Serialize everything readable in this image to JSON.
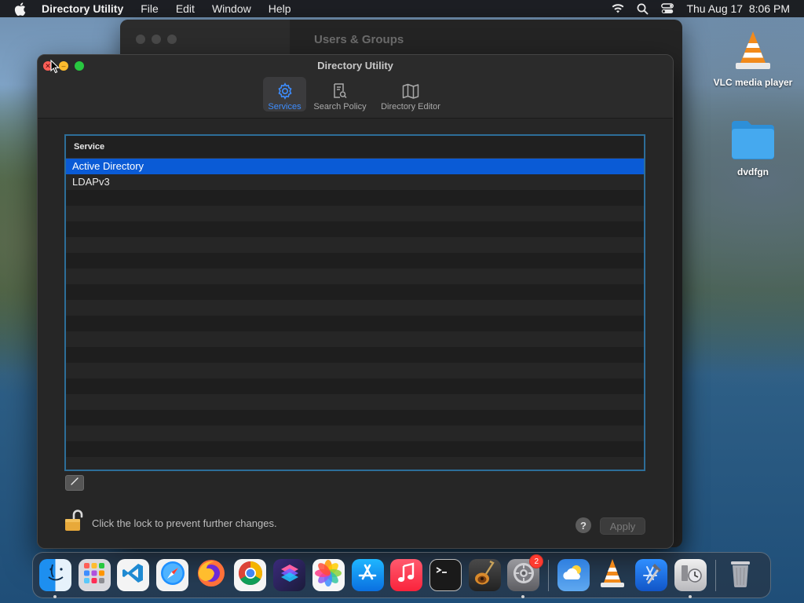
{
  "menubar": {
    "app_name": "Directory Utility",
    "items": [
      "File",
      "Edit",
      "Window",
      "Help"
    ],
    "datetime": "Thu Aug 17  8:06 PM"
  },
  "desktop": {
    "icons": [
      {
        "label": "VLC media player",
        "icon": "vlc-cone-icon"
      },
      {
        "label": "dvdfgn",
        "icon": "folder-icon"
      }
    ]
  },
  "background_window": {
    "title": "Users & Groups"
  },
  "window": {
    "title": "Directory Utility",
    "toolbar": [
      {
        "label": "Services",
        "icon": "gear-icon",
        "active": true
      },
      {
        "label": "Search Policy",
        "icon": "search-policy-icon",
        "active": false
      },
      {
        "label": "Directory Editor",
        "icon": "map-icon",
        "active": false
      }
    ],
    "table": {
      "column_header": "Service",
      "rows": [
        {
          "label": "Active Directory",
          "selected": true
        },
        {
          "label": "LDAPv3",
          "selected": false
        }
      ]
    },
    "lock_text": "Click the lock to prevent further changes.",
    "help_label": "?",
    "apply_label": "Apply"
  },
  "dock": {
    "apps": [
      {
        "name": "Finder",
        "icon": "finder-icon",
        "running": true
      },
      {
        "name": "Launchpad",
        "icon": "launchpad-icon",
        "running": false
      },
      {
        "name": "Visual Studio Code",
        "icon": "vscode-icon",
        "running": false
      },
      {
        "name": "Safari",
        "icon": "safari-icon",
        "running": false
      },
      {
        "name": "Firefox",
        "icon": "firefox-icon",
        "running": false
      },
      {
        "name": "Chrome",
        "icon": "chrome-icon",
        "running": false
      },
      {
        "name": "Shortcuts",
        "icon": "shortcuts-icon",
        "running": false
      },
      {
        "name": "Photos",
        "icon": "photos-icon",
        "running": false
      },
      {
        "name": "App Store",
        "icon": "app-store-icon",
        "running": false
      },
      {
        "name": "Music",
        "icon": "music-icon",
        "running": false
      },
      {
        "name": "Terminal",
        "icon": "terminal-icon",
        "running": false
      },
      {
        "name": "GarageBand",
        "icon": "garageband-icon",
        "running": false
      },
      {
        "name": "System Settings",
        "icon": "system-settings-icon",
        "running": true,
        "badge": "2"
      },
      {
        "name": "Weather",
        "icon": "weather-icon",
        "running": false
      },
      {
        "name": "VLC",
        "icon": "vlc-icon",
        "running": false
      },
      {
        "name": "Xcode",
        "icon": "xcode-icon",
        "running": false
      },
      {
        "name": "Directory Utility",
        "icon": "directory-utility-icon",
        "running": true
      },
      {
        "name": "Trash",
        "icon": "trash-icon",
        "running": false
      }
    ]
  }
}
